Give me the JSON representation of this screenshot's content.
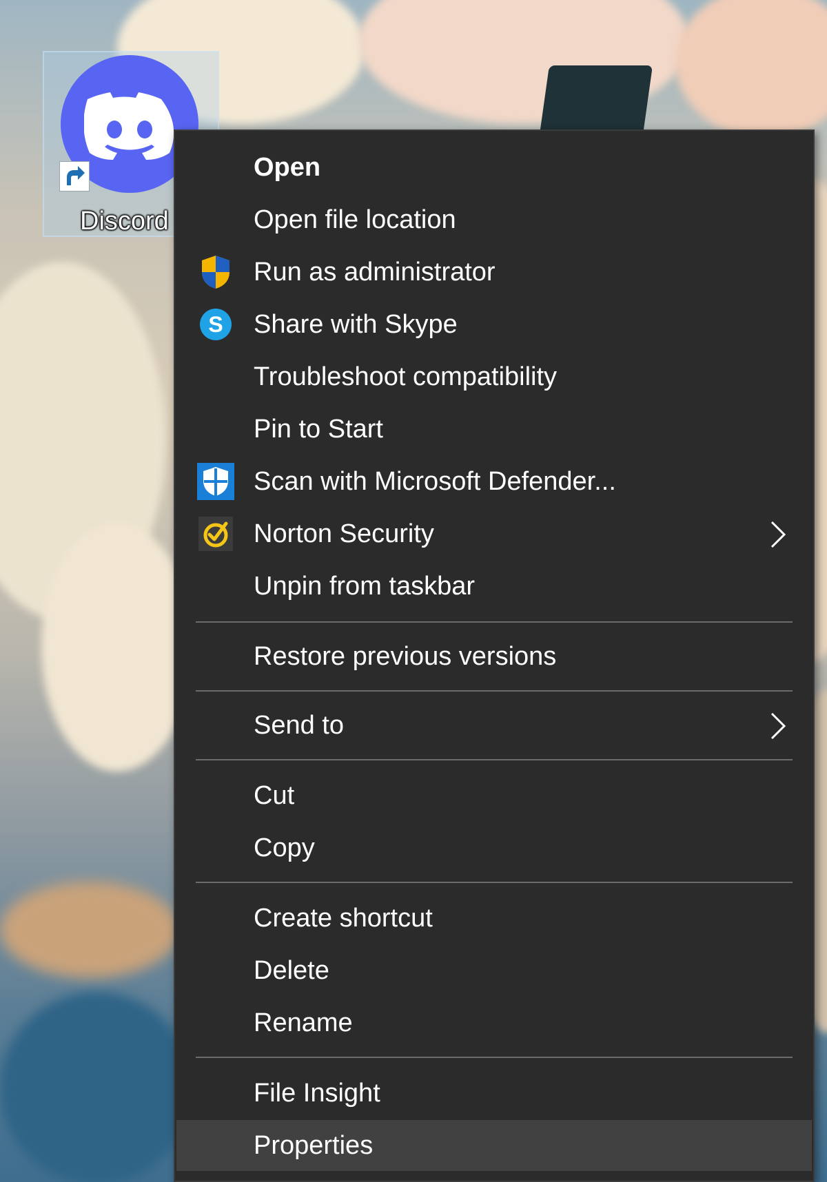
{
  "desktop": {
    "icon": {
      "label": "Discord",
      "logo_icon": "discord-logo-icon",
      "badge_icon": "shortcut-arrow-icon"
    }
  },
  "context_menu": {
    "items": [
      {
        "label": "Open",
        "bold": true
      },
      {
        "label": "Open file location"
      },
      {
        "label": "Run as administrator",
        "icon": "uac-shield-icon"
      },
      {
        "label": "Share with Skype",
        "icon": "skype-icon"
      },
      {
        "label": "Troubleshoot compatibility"
      },
      {
        "label": "Pin to Start"
      },
      {
        "label": "Scan with Microsoft Defender...",
        "icon": "defender-shield-icon"
      },
      {
        "label": "Norton Security",
        "icon": "norton-icon",
        "submenu": true
      },
      {
        "label": "Unpin from taskbar"
      },
      {
        "label": "Restore previous versions"
      },
      {
        "label": "Send to",
        "submenu": true
      },
      {
        "label": "Cut"
      },
      {
        "label": "Copy"
      },
      {
        "label": "Create shortcut"
      },
      {
        "label": "Delete"
      },
      {
        "label": "Rename"
      },
      {
        "label": "File Insight"
      },
      {
        "label": "Properties",
        "highlighted": true
      }
    ]
  },
  "colors": {
    "menu_background": "#2b2b2b",
    "menu_highlight": "#414141",
    "separator": "#6b6b6b",
    "discord_blurple": "#5865f2"
  }
}
